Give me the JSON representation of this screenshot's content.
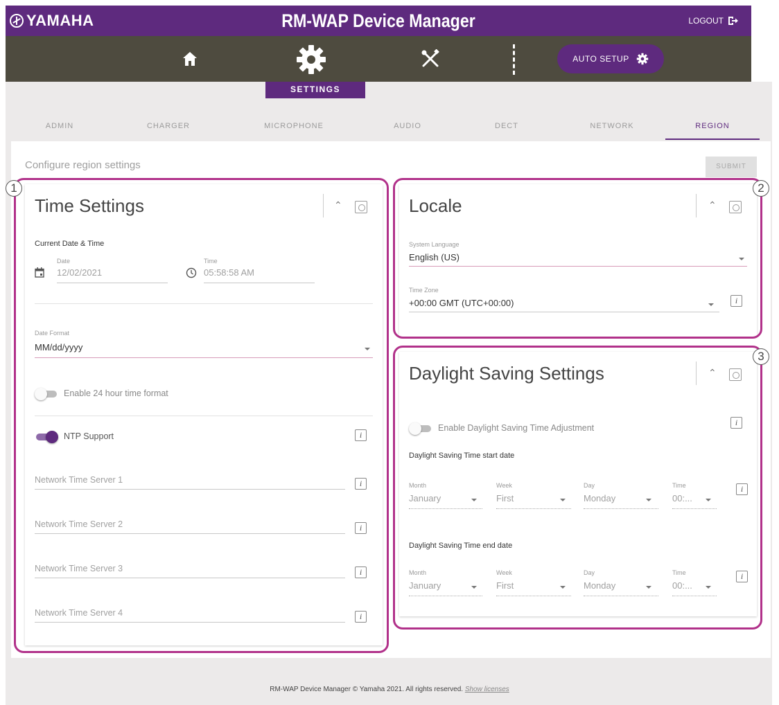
{
  "brand": {
    "name": "YAMAHA",
    "icon": "yamaha-tuning-fork-icon"
  },
  "header": {
    "title": "RM-WAP Device Manager",
    "logout_label": "LOGOUT",
    "logout_icon": "logout-icon"
  },
  "iconbar": {
    "icons": [
      "home-icon",
      "gear-icon",
      "tools-icon"
    ],
    "auto_setup_label": "AUTO SETUP",
    "active_label": "SETTINGS"
  },
  "tabs": [
    {
      "label": "ADMIN"
    },
    {
      "label": "CHARGER"
    },
    {
      "label": "MICROPHONE"
    },
    {
      "label": "AUDIO"
    },
    {
      "label": "DECT"
    },
    {
      "label": "NETWORK"
    },
    {
      "label": "REGION",
      "active": true
    }
  ],
  "page": {
    "description": "Configure region settings",
    "submit_label": "SUBMIT"
  },
  "markers": [
    "1",
    "2",
    "3"
  ],
  "time_settings": {
    "title": "Time Settings",
    "current_label": "Current Date & Time",
    "date_label": "Date",
    "date_value": "12/02/2021",
    "time_label": "Time",
    "time_value": "05:58:58 AM",
    "date_format_label": "Date Format",
    "date_format_value": "MM/dd/yyyy",
    "enable24_label": "Enable 24 hour time format",
    "enable24_on": false,
    "ntp_label": "NTP Support",
    "ntp_on": true,
    "servers": [
      "Network Time Server 1",
      "Network Time Server 2",
      "Network Time Server 3",
      "Network Time Server 4"
    ]
  },
  "locale": {
    "title": "Locale",
    "language_label": "System Language",
    "language_value": "English (US)",
    "timezone_label": "Time Zone",
    "timezone_value": "+00:00 GMT (UTC+00:00)"
  },
  "dst": {
    "title": "Daylight Saving Settings",
    "enable_label": "Enable Daylight Saving Time Adjustment",
    "enable_on": false,
    "start_label": "Daylight Saving Time start date",
    "end_label": "Daylight Saving Time end date",
    "start": {
      "month_label": "Month",
      "month": "January",
      "week_label": "Week",
      "week": "First",
      "day_label": "Day",
      "day": "Monday",
      "time_label": "Time",
      "time": "00:..."
    },
    "end": {
      "month_label": "Month",
      "month": "January",
      "week_label": "Week",
      "week": "First",
      "day_label": "Day",
      "day": "Monday",
      "time_label": "Time",
      "time": "00:..."
    }
  },
  "footer": {
    "text": "RM-WAP Device Manager © Yamaha 2021. All rights reserved.",
    "link": "Show licenses"
  },
  "colors": {
    "brand_purple": "#5e2a7e",
    "iconbar": "#4e4b3f",
    "callout": "#b1318a"
  }
}
